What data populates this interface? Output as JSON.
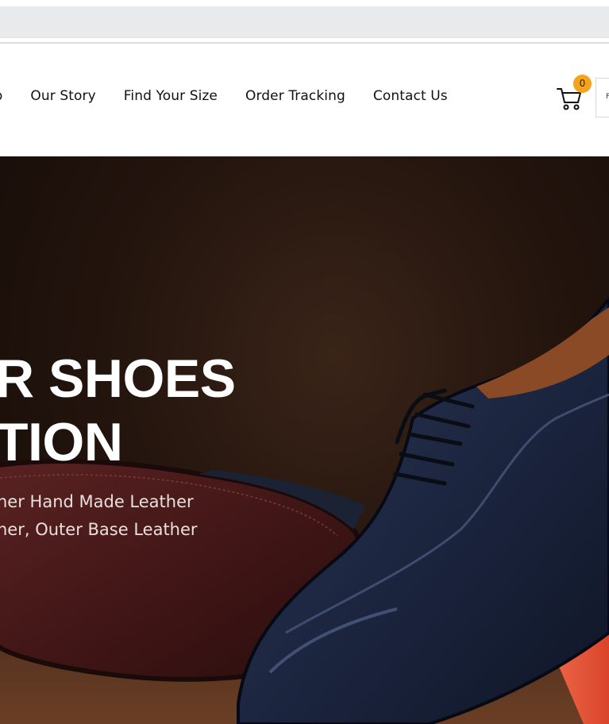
{
  "nav": {
    "items": [
      {
        "label": "op"
      },
      {
        "label": "Our Story"
      },
      {
        "label": "Find Your Size"
      },
      {
        "label": "Order Tracking"
      },
      {
        "label": "Contact Us"
      }
    ]
  },
  "cart": {
    "icon": "cart-icon",
    "count": "0",
    "badge_color": "#f7a21b"
  },
  "side_box": {
    "label": "F"
  },
  "hero": {
    "title_line1": "R SHOES",
    "title_line2": "TION",
    "subtitle_line1": "her Hand Made Leather",
    "subtitle_line2": "her, Outer Base Leather"
  },
  "colors": {
    "address_bar": "#e9eaeb",
    "hero_dark": "#140b07",
    "shoe_navy": "#1e2a44",
    "sole_maroon": "#4a1c1c",
    "accent_orange": "#e8583a"
  }
}
